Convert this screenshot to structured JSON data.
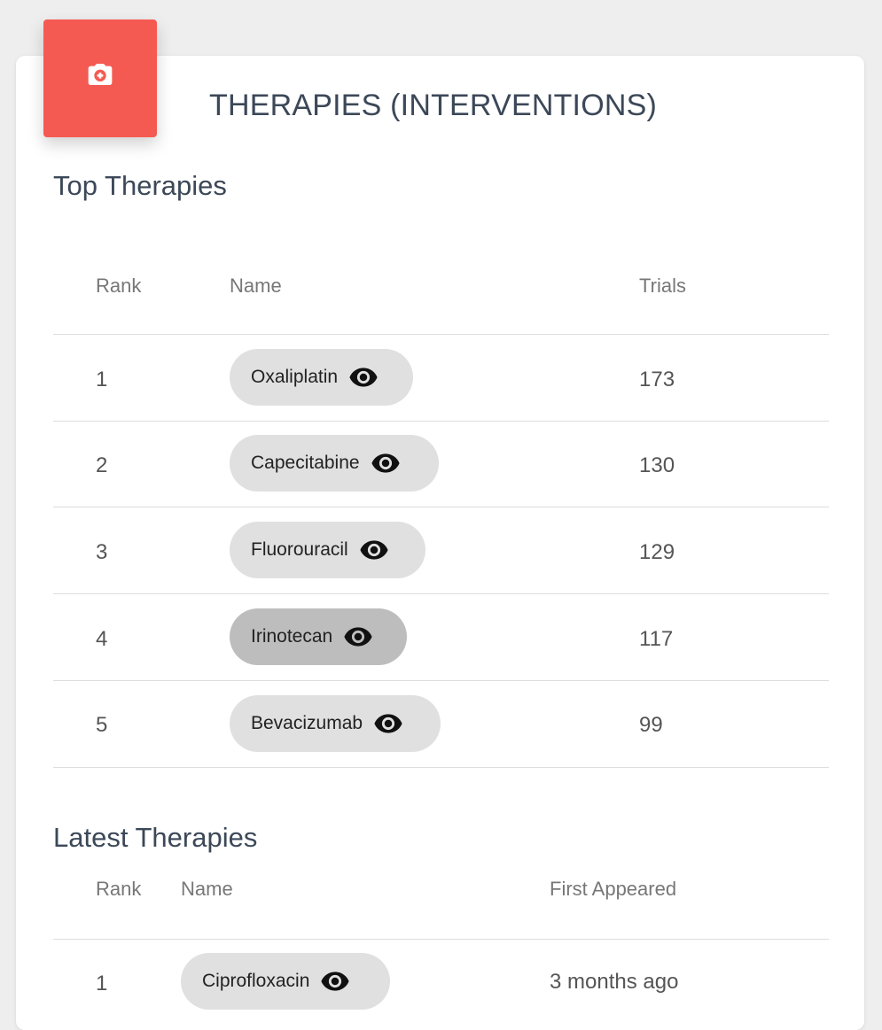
{
  "card": {
    "title": "THERAPIES (INTERVENTIONS)",
    "header_icon": "camera-plus-icon",
    "accent_color": "#f55a52"
  },
  "top": {
    "section_title": "Top Therapies",
    "columns": {
      "rank": "Rank",
      "name": "Name",
      "trials": "Trials"
    },
    "rows": [
      {
        "rank": "1",
        "name": "Oxaliplatin",
        "trials": "173"
      },
      {
        "rank": "2",
        "name": "Capecitabine",
        "trials": "130"
      },
      {
        "rank": "3",
        "name": "Fluorouracil",
        "trials": "129"
      },
      {
        "rank": "4",
        "name": "Irinotecan",
        "trials": "117"
      },
      {
        "rank": "5",
        "name": "Bevacizumab",
        "trials": "99"
      }
    ]
  },
  "latest": {
    "section_title": "Latest Therapies",
    "columns": {
      "rank": "Rank",
      "name": "Name",
      "first_appeared": "First Appeared"
    },
    "rows": [
      {
        "rank": "1",
        "name": "Ciprofloxacin",
        "first_appeared": "3 months ago"
      }
    ]
  },
  "chip_icon": "eye-icon"
}
